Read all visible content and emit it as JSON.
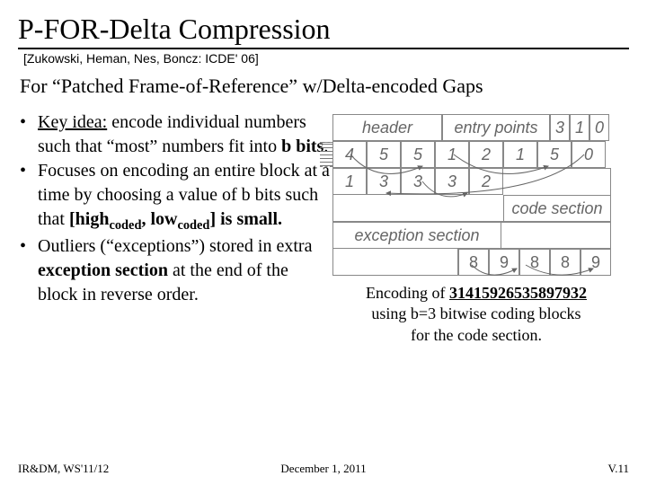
{
  "title": "P-FOR-Delta Compression",
  "citation": "[Zukowski, Heman, Nes, Boncz: ICDE' 06]",
  "subtitle": "For “Patched Frame-of-Reference” w/Delta-encoded Gaps",
  "bullets": {
    "b1_pre": "Key idea:",
    "b1_post": " encode individual numbers such that “most” numbers fit into ",
    "b1_bold": "b bits",
    "b1_end": ".",
    "b2_pre": "Focuses on encoding an entire block at a time by choosing a value of b bits such that ",
    "b2_bracket_open": "[high",
    "b2_sub1": "coded",
    "b2_mid": ", low",
    "b2_sub2": "coded",
    "b2_bracket_close": "] is small.",
    "b3_pre": "Outliers (“exceptions”) stored in extra ",
    "b3_bold": "exception section",
    "b3_post": " at the end of the block in reverse order."
  },
  "diagram": {
    "header": "header",
    "entry_points": "entry points",
    "top_nums": [
      "3",
      "1",
      "0"
    ],
    "row2": [
      "4",
      "5",
      "5",
      "1",
      "2",
      "1",
      "5",
      "0"
    ],
    "row3": [
      "1",
      "3",
      "3",
      "3",
      "2"
    ],
    "code_section": "code section",
    "exception_section": "exception section",
    "exc_nums": [
      "8",
      "9",
      "8",
      "8",
      "9"
    ]
  },
  "caption": {
    "line1_pre": "Encoding of ",
    "line1_num": "31415926535897932",
    "line2": "using b=3 bitwise coding blocks",
    "line3": "for the code section."
  },
  "footer": {
    "left": "IR&DM, WS'11/12",
    "center": "December 1, 2011",
    "right": "V.11"
  }
}
